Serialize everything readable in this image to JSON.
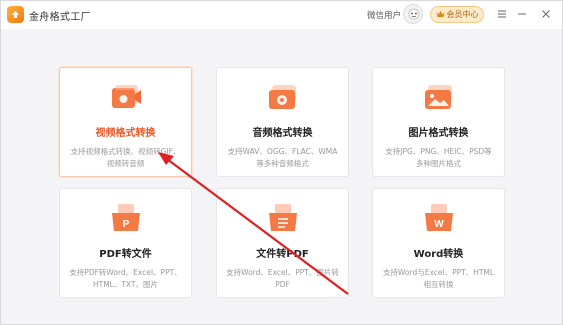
{
  "app": {
    "title": "金舟格式工厂",
    "user_name": "微信用户",
    "vip_label": "会员中心",
    "accent_color": "#f26b3a"
  },
  "window_controls": [
    "menu-icon",
    "minimize-icon",
    "close-icon"
  ],
  "cards": [
    {
      "title": "视频格式转换",
      "desc": "支持视频格式转换、视频转GIF、视频转音频",
      "icon": "video-icon",
      "active": true
    },
    {
      "title": "音频格式转换",
      "desc": "支持WAV、OGG、FLAC、WMA等多种音频格式",
      "icon": "audio-icon",
      "active": false
    },
    {
      "title": "图片格式转换",
      "desc": "支持JPG、PNG、HEIC、PSD等多种图片格式",
      "icon": "image-icon",
      "active": false
    },
    {
      "title": "PDF转文件",
      "desc": "支持PDF转Word、Excel、PPT、HTML、TXT、图片",
      "icon": "pdf-icon",
      "active": false
    },
    {
      "title": "文件转PDF",
      "desc": "支持Word、Excel、PPT、图片转PDF",
      "icon": "file-to-pdf-icon",
      "active": false
    },
    {
      "title": "Word转换",
      "desc": "支持Word与Excel、PPT、HTML相互转换",
      "icon": "word-icon",
      "active": false
    }
  ]
}
